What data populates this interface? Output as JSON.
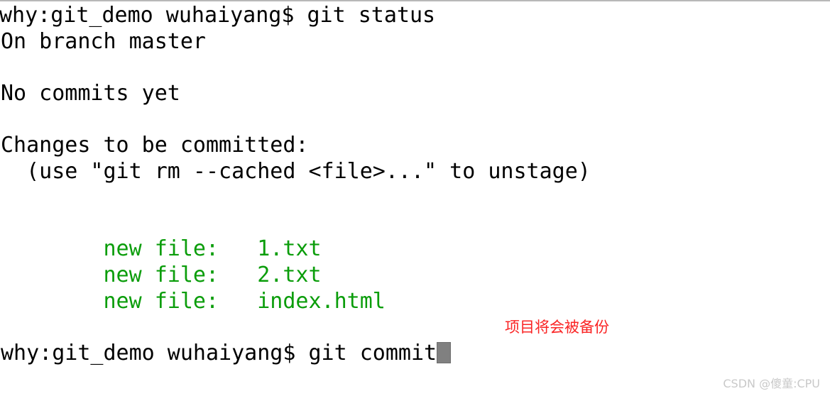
{
  "terminal": {
    "background_color": "#ffffff",
    "foreground_color": "#000000",
    "green_color": "#0b9d0b",
    "cursor_color": "#808080",
    "lines": [
      {
        "text": "why:git_demo wuhaiyang$ git status",
        "color": "default",
        "clipped_left": true
      },
      {
        "text": "On branch master",
        "color": "default"
      },
      {
        "text": "",
        "color": "default"
      },
      {
        "text": "No commits yet",
        "color": "default"
      },
      {
        "text": "",
        "color": "default"
      },
      {
        "text": "Changes to be committed:",
        "color": "default"
      },
      {
        "text": "  (use \"git rm --cached <file>...\" to unstage)",
        "color": "default"
      },
      {
        "text": "",
        "color": "default"
      },
      {
        "text": "",
        "color": "default"
      },
      {
        "text": "        new file:   1.txt",
        "color": "green"
      },
      {
        "text": "        new file:   2.txt",
        "color": "green"
      },
      {
        "text": "        new file:   index.html",
        "color": "green"
      },
      {
        "text": "",
        "color": "default"
      }
    ],
    "prompt": {
      "text": "why:git_demo wuhaiyang$ git commit",
      "cursor": "block-cursor"
    }
  },
  "annotation": {
    "text": "项目将会被备份",
    "color": "#fa2424"
  },
  "watermark": {
    "text": "CSDN @傻童:CPU",
    "color": "#c9c9c9"
  }
}
